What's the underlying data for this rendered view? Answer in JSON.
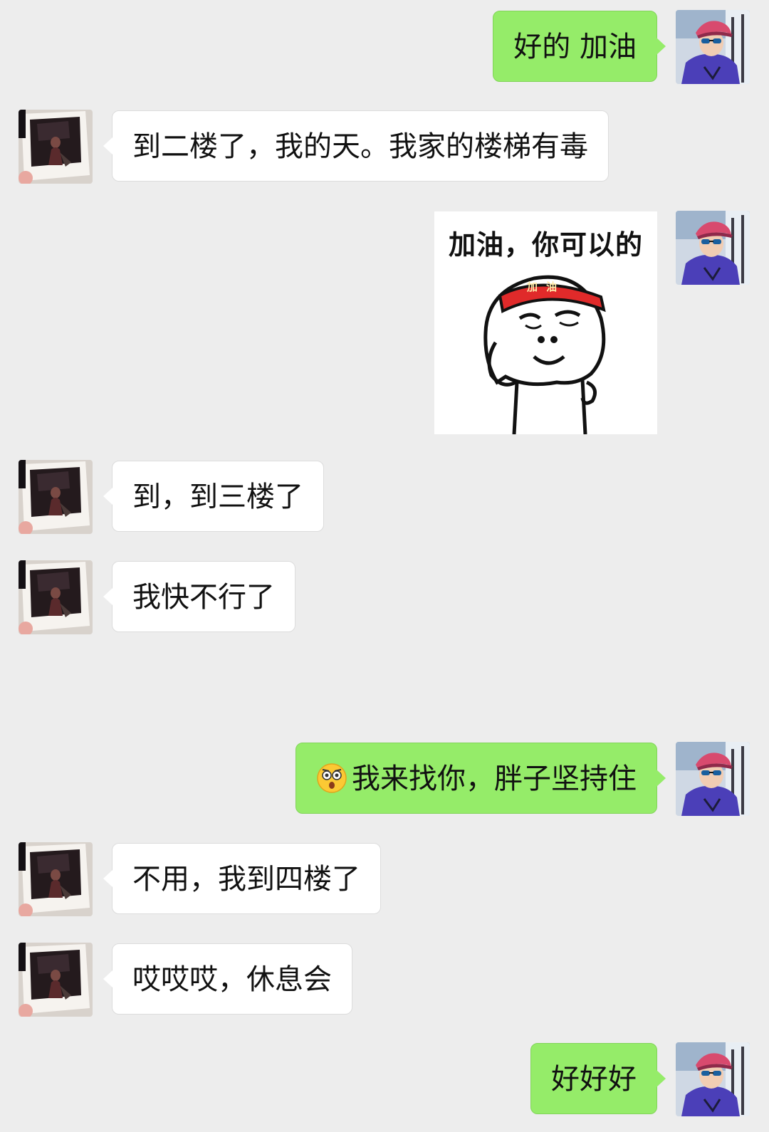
{
  "messages": [
    {
      "side": "out",
      "type": "text",
      "text": "好的 加油"
    },
    {
      "side": "in",
      "type": "text",
      "text": "到二楼了，我的天。我家的楼梯有毒"
    },
    {
      "side": "out",
      "type": "sticker",
      "caption": "加油，你可以的",
      "headband_text": "加油"
    },
    {
      "side": "in",
      "type": "text",
      "text": "到，到三楼了"
    },
    {
      "side": "in",
      "type": "text",
      "text": "我快不行了"
    },
    {
      "side": "out",
      "type": "text",
      "emoji": "surprised-face-emoji",
      "text": "我来找你，胖子坚持住"
    },
    {
      "side": "in",
      "type": "text",
      "text": "不用，我到四楼了"
    },
    {
      "side": "in",
      "type": "text",
      "text": "哎哎哎，休息会"
    },
    {
      "side": "out",
      "type": "text",
      "text": "好好好"
    }
  ],
  "colors": {
    "background": "#ededed",
    "outgoing_bubble": "#95ec69",
    "incoming_bubble": "#ffffff"
  },
  "icons": {
    "self_avatar": "user-avatar-cap-sunglasses",
    "other_avatar": "contact-avatar-polaroid-photo"
  }
}
